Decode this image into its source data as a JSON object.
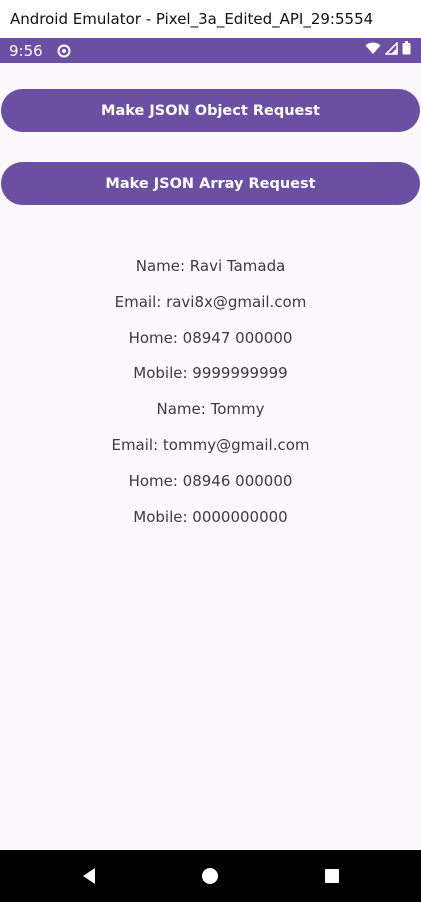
{
  "window": {
    "title": "Android Emulator - Pixel_3a_Edited_API_29:5554"
  },
  "status_bar": {
    "time": "9:56",
    "icons": [
      "sync-icon",
      "wifi-icon",
      "signal-icon",
      "battery-icon"
    ]
  },
  "buttons": {
    "object_request_label": "Make JSON Object Request",
    "array_request_label": "Make JSON Array Request"
  },
  "results": [
    "Name: Ravi Tamada",
    "Email: ravi8x@gmail.com",
    "Home: 08947 000000",
    "Mobile: 9999999999",
    "Name: Tommy",
    "Email: tommy@gmail.com",
    "Home: 08946 000000",
    "Mobile: 0000000000"
  ],
  "nav_bar": {
    "icons": [
      "back-icon",
      "home-icon",
      "recents-icon"
    ]
  },
  "colors": {
    "primary": "#6a4fa2",
    "background": "#fdf8fc",
    "text": "#3d3a40",
    "nav_bar": "#000000"
  }
}
